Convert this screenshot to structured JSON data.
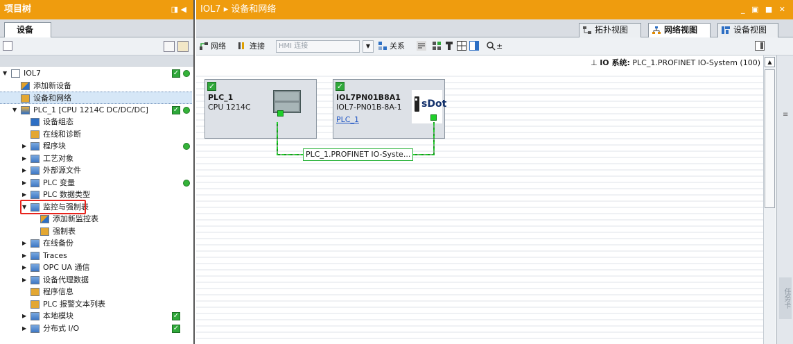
{
  "left_panel": {
    "title": "项目树",
    "title_controls": "◨ ◀",
    "tab": "设备"
  },
  "tree": [
    {
      "label": "IOL7",
      "indent": 0,
      "arrow": "▼",
      "icon": "project-icon",
      "check": true,
      "dot": true
    },
    {
      "label": "添加新设备",
      "indent": 1,
      "arrow": "",
      "icon": "add-device-icon"
    },
    {
      "label": "设备和网络",
      "indent": 1,
      "arrow": "",
      "icon": "network-icon",
      "selected": true
    },
    {
      "label": "PLC_1 [CPU 1214C DC/DC/DC]",
      "indent": 1,
      "arrow": "▼",
      "icon": "plc-icon",
      "check": true,
      "dot": true
    },
    {
      "label": "设备组态",
      "indent": 2,
      "arrow": "",
      "icon": "device-config-icon"
    },
    {
      "label": "在线和诊断",
      "indent": 2,
      "arrow": "",
      "icon": "online-diag-icon"
    },
    {
      "label": "程序块",
      "indent": 2,
      "arrow": "▶",
      "icon": "folder-icon",
      "dot": true
    },
    {
      "label": "工艺对象",
      "indent": 2,
      "arrow": "▶",
      "icon": "folder-icon"
    },
    {
      "label": "外部源文件",
      "indent": 2,
      "arrow": "▶",
      "icon": "folder-icon"
    },
    {
      "label": "PLC 变量",
      "indent": 2,
      "arrow": "▶",
      "icon": "folder-icon",
      "dot": true
    },
    {
      "label": "PLC 数据类型",
      "indent": 2,
      "arrow": "▶",
      "icon": "folder-icon"
    },
    {
      "label": "监控与强制表",
      "indent": 2,
      "arrow": "▼",
      "icon": "folder-icon",
      "highlight": true
    },
    {
      "label": "添加新监控表",
      "indent": 3,
      "arrow": "",
      "icon": "add-table-icon"
    },
    {
      "label": "强制表",
      "indent": 3,
      "arrow": "",
      "icon": "force-table-icon"
    },
    {
      "label": "在线备份",
      "indent": 2,
      "arrow": "▶",
      "icon": "folder-icon"
    },
    {
      "label": "Traces",
      "indent": 2,
      "arrow": "▶",
      "icon": "folder-icon"
    },
    {
      "label": "OPC UA 通信",
      "indent": 2,
      "arrow": "▶",
      "icon": "folder-icon"
    },
    {
      "label": "设备代理数据",
      "indent": 2,
      "arrow": "▶",
      "icon": "folder-icon"
    },
    {
      "label": "程序信息",
      "indent": 2,
      "arrow": "",
      "icon": "program-info-icon"
    },
    {
      "label": "PLC 报警文本列表",
      "indent": 2,
      "arrow": "",
      "icon": "alarm-text-icon"
    },
    {
      "label": "本地模块",
      "indent": 2,
      "arrow": "▶",
      "icon": "folder-icon",
      "check": true
    },
    {
      "label": "分布式 I/O",
      "indent": 2,
      "arrow": "▶",
      "icon": "folder-icon",
      "check": true
    }
  ],
  "right_panel": {
    "breadcrumb": "IOL7 ▸ 设备和网络",
    "window_controls": "_ ▣ ■ ✕",
    "view_tabs": {
      "topology": "拓扑视图",
      "network": "网络视图",
      "device": "设备视图"
    },
    "toolbar": {
      "network": "网络",
      "connect": "连接",
      "hmi_connection": "HMI 连接",
      "relations": "关系",
      "zoom": "±"
    },
    "io_system_label": "IO 系统:",
    "io_system_value": "PLC_1.PROFINET IO-System (100)"
  },
  "devices": {
    "plc": {
      "name": "PLC_1",
      "type": "CPU 1214C"
    },
    "io": {
      "name": "IOL7PN01B8A1",
      "type": "IOL7-PN01B-8A-1",
      "link": "PLC_1",
      "logo": "sDot"
    }
  },
  "network_label": "PLC_1.PROFINET IO-Syste...",
  "side_strip_text": "任务卡",
  "colors": {
    "title_bar": "#ef9c0e",
    "check_green": "#2fa83a",
    "status_dot": "#34b339",
    "highlight_red": "#e8231c",
    "profinet_green": "#1fcf2a"
  }
}
